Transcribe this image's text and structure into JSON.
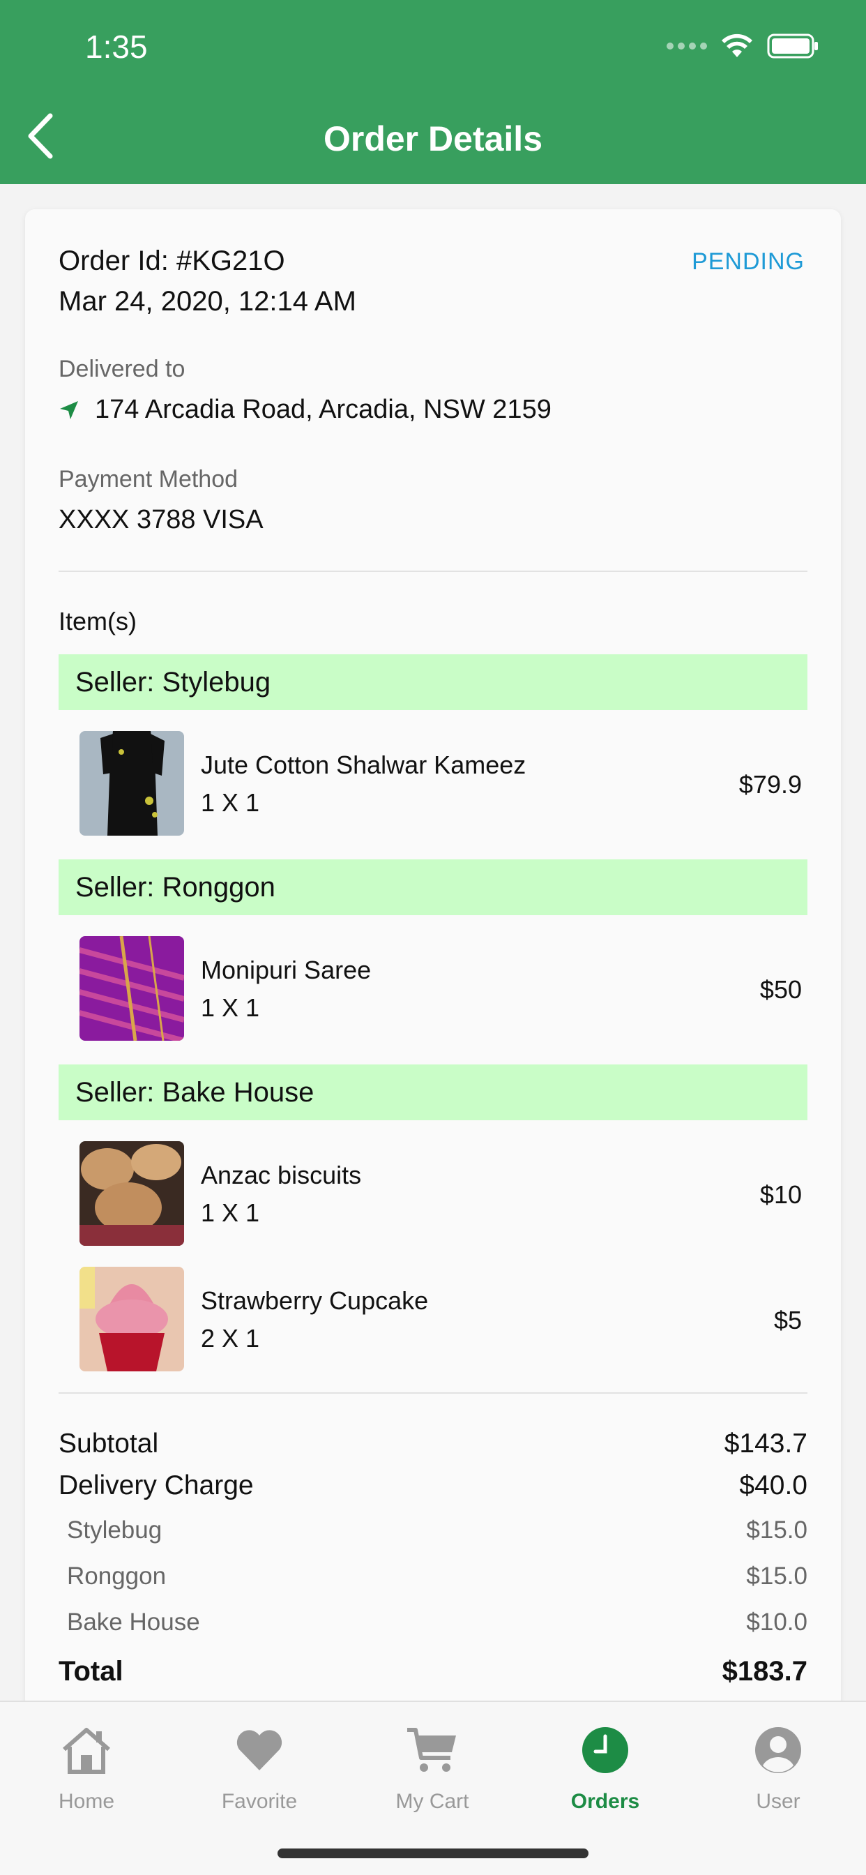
{
  "status_bar": {
    "time": "1:35"
  },
  "header": {
    "title": "Order Details"
  },
  "order": {
    "id_label": "Order Id: #KG21O",
    "status": "PENDING",
    "date": "Mar 24, 2020, 12:14 AM",
    "delivered_label": "Delivered to",
    "address": "174 Arcadia Road, Arcadia, NSW 2159",
    "payment_label": "Payment Method",
    "payment_value": "XXXX 3788 VISA",
    "items_label": "Item(s)"
  },
  "sellers": [
    {
      "label": "Seller: Stylebug"
    },
    {
      "label": "Seller: Ronggon"
    },
    {
      "label": "Seller: Bake House"
    }
  ],
  "items": [
    {
      "name": "Jute Cotton Shalwar Kameez",
      "qty": "1 X 1",
      "price": "$79.9"
    },
    {
      "name": "Monipuri Saree",
      "qty": "1 X 1",
      "price": "$50"
    },
    {
      "name": "Anzac biscuits",
      "qty": "1 X 1",
      "price": "$10"
    },
    {
      "name": "Strawberry Cupcake",
      "qty": "2 X 1",
      "price": "$5"
    }
  ],
  "summary": {
    "subtotal_label": "Subtotal",
    "subtotal_value": "$143.7",
    "delivery_label": "Delivery Charge",
    "delivery_value": "$40.0",
    "charges": [
      {
        "label": "Stylebug",
        "value": "$15.0"
      },
      {
        "label": "Ronggon",
        "value": "$15.0"
      },
      {
        "label": "Bake House",
        "value": "$10.0"
      }
    ],
    "total_label": "Total",
    "total_value": "$183.7"
  },
  "tabs": [
    {
      "label": "Home",
      "icon": "home-icon"
    },
    {
      "label": "Favorite",
      "icon": "heart-icon"
    },
    {
      "label": "My Cart",
      "icon": "cart-icon"
    },
    {
      "label": "Orders",
      "icon": "clock-icon",
      "active": true
    },
    {
      "label": "User",
      "icon": "user-icon"
    }
  ],
  "colors": {
    "header": "#389f5e",
    "status_pending": "#1e9ad6",
    "seller_bar": "#c9fdc7",
    "tab_active": "#1d8c45",
    "tab_inactive": "#999999"
  }
}
